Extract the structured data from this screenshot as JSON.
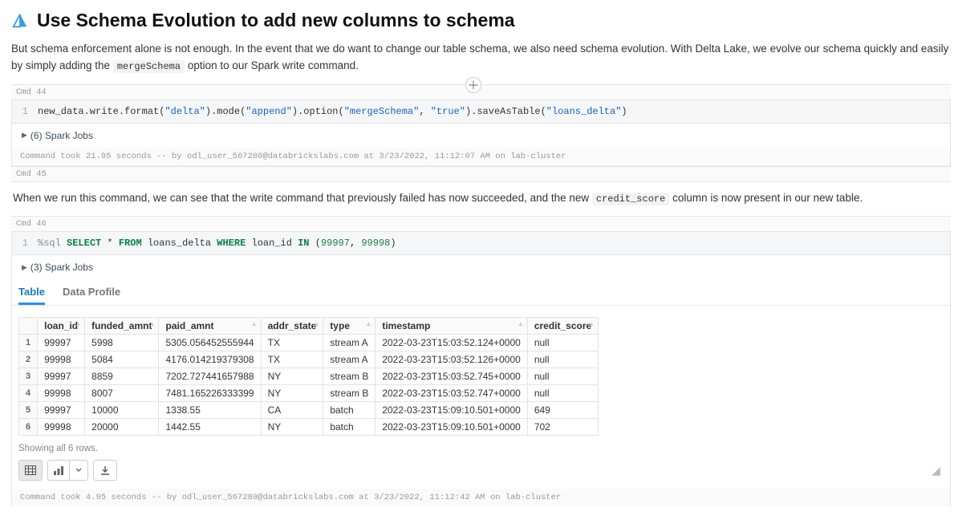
{
  "header": {
    "title": "Use Schema Evolution to add new columns to schema"
  },
  "intro": {
    "pre": "But schema enforcement alone is not enough. In the event that we do want to change our table schema, we also need schema evolution. With Delta Lake, we evolve our schema quickly and easily by simply adding the ",
    "code": "mergeSchema",
    "post": " option to our Spark write command."
  },
  "cmd44": {
    "label": "Cmd 44",
    "code": {
      "line_no": "1",
      "p0": "new_data.write.format(",
      "s0": "\"delta\"",
      "p1": ").mode(",
      "s1": "\"append\"",
      "p2": ").option(",
      "s2": "\"mergeSchema\"",
      "comma": ", ",
      "s3": "\"true\"",
      "p3": ").saveAsTable(",
      "s4": "\"loans_delta\"",
      "p4": ")"
    },
    "jobs": "(6) Spark Jobs",
    "status": "Command took 21.95 seconds -- by odl_user_567280@databrickslabs.com at 3/23/2022, 11:12:07 AM on lab-cluster"
  },
  "cmd45": {
    "label": "Cmd 45",
    "text_pre": "When we run this command, we can see that the write command that previously failed has now succeeded, and the new ",
    "text_code": "credit_score",
    "text_post": " column is now present in our new table."
  },
  "cmd46": {
    "label": "Cmd 46",
    "code": {
      "line_no": "1",
      "magic": "%sql ",
      "kw1": "SELECT",
      "star": " * ",
      "kw2": "FROM",
      "tbl": " loans_delta ",
      "kw3": "WHERE",
      "col": " loan_id ",
      "kw4": "IN",
      "open": " (",
      "n1": "99997",
      "comma": ", ",
      "n2": "99998",
      "close": ")"
    },
    "jobs": "(3) Spark Jobs",
    "tabs": {
      "table": "Table",
      "profile": "Data Profile"
    },
    "columns": [
      "loan_id",
      "funded_amnt",
      "paid_amnt",
      "addr_state",
      "type",
      "timestamp",
      "credit_score"
    ],
    "rows": [
      {
        "idx": "1",
        "loan_id": "99997",
        "funded_amnt": "5998",
        "paid_amnt": "5305.056452555944",
        "addr_state": "TX",
        "type": "stream A",
        "timestamp": "2022-03-23T15:03:52.124+0000",
        "credit_score": "null"
      },
      {
        "idx": "2",
        "loan_id": "99998",
        "funded_amnt": "5084",
        "paid_amnt": "4176.014219379308",
        "addr_state": "TX",
        "type": "stream A",
        "timestamp": "2022-03-23T15:03:52.126+0000",
        "credit_score": "null"
      },
      {
        "idx": "3",
        "loan_id": "99997",
        "funded_amnt": "8859",
        "paid_amnt": "7202.727441657988",
        "addr_state": "NY",
        "type": "stream B",
        "timestamp": "2022-03-23T15:03:52.745+0000",
        "credit_score": "null"
      },
      {
        "idx": "4",
        "loan_id": "99998",
        "funded_amnt": "8007",
        "paid_amnt": "7481.165226333399",
        "addr_state": "NY",
        "type": "stream B",
        "timestamp": "2022-03-23T15:03:52.747+0000",
        "credit_score": "null"
      },
      {
        "idx": "5",
        "loan_id": "99997",
        "funded_amnt": "10000",
        "paid_amnt": "1338.55",
        "addr_state": "CA",
        "type": "batch",
        "timestamp": "2022-03-23T15:09:10.501+0000",
        "credit_score": "649"
      },
      {
        "idx": "6",
        "loan_id": "99998",
        "funded_amnt": "20000",
        "paid_amnt": "1442.55",
        "addr_state": "NY",
        "type": "batch",
        "timestamp": "2022-03-23T15:09:10.501+0000",
        "credit_score": "702"
      }
    ],
    "row_count_text": "Showing all 6 rows.",
    "status": "Command took 4.95 seconds -- by odl_user_567280@databrickslabs.com at 3/23/2022, 11:12:42 AM on lab-cluster"
  }
}
